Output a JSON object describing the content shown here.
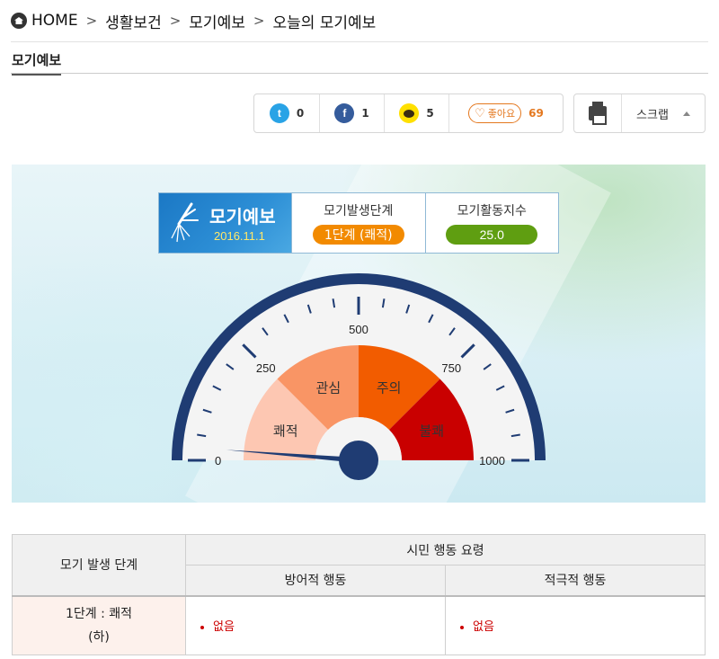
{
  "breadcrumb": {
    "home": "HOME",
    "items": [
      "생활보건",
      "모기예보",
      "오늘의 모기예보"
    ],
    "separator": ">"
  },
  "section_title": "모기예보",
  "share": {
    "twitter_count": "0",
    "facebook_count": "1",
    "kakaostory_count": "5",
    "like_label": "좋아요",
    "like_count": "69"
  },
  "scrap": {
    "label": "스크랩"
  },
  "forecast": {
    "brand_title": "모기예보",
    "date": "2016.11.1",
    "stage_label": "모기발생단계",
    "stage_value": "1단계 (쾌적)",
    "index_label": "모기활동지수",
    "index_value": "25.0",
    "index_numeric": 25.0,
    "stage_color": "#f28a00",
    "index_color": "#5f9e11"
  },
  "gauge": {
    "min": 0,
    "max": 1000,
    "value": 25.0,
    "tick_labels": [
      "0",
      "250",
      "500",
      "750",
      "1000"
    ],
    "zones": [
      {
        "label": "쾌적",
        "color": "#fdc7b2"
      },
      {
        "label": "관심",
        "color": "#f99565"
      },
      {
        "label": "주의",
        "color": "#f25c00"
      },
      {
        "label": "불쾌",
        "color": "#c90000"
      }
    ],
    "frame_color": "#1f3c73"
  },
  "table": {
    "col_stage": "모기 발생 단계",
    "col_group": "시민 행동 요령",
    "col_defensive": "방어적 행동",
    "col_active": "적극적 행동",
    "row": {
      "stage_line1": "1단계 : 쾌적",
      "stage_line2": "(하)",
      "defensive": "없음",
      "active": "없음"
    }
  }
}
